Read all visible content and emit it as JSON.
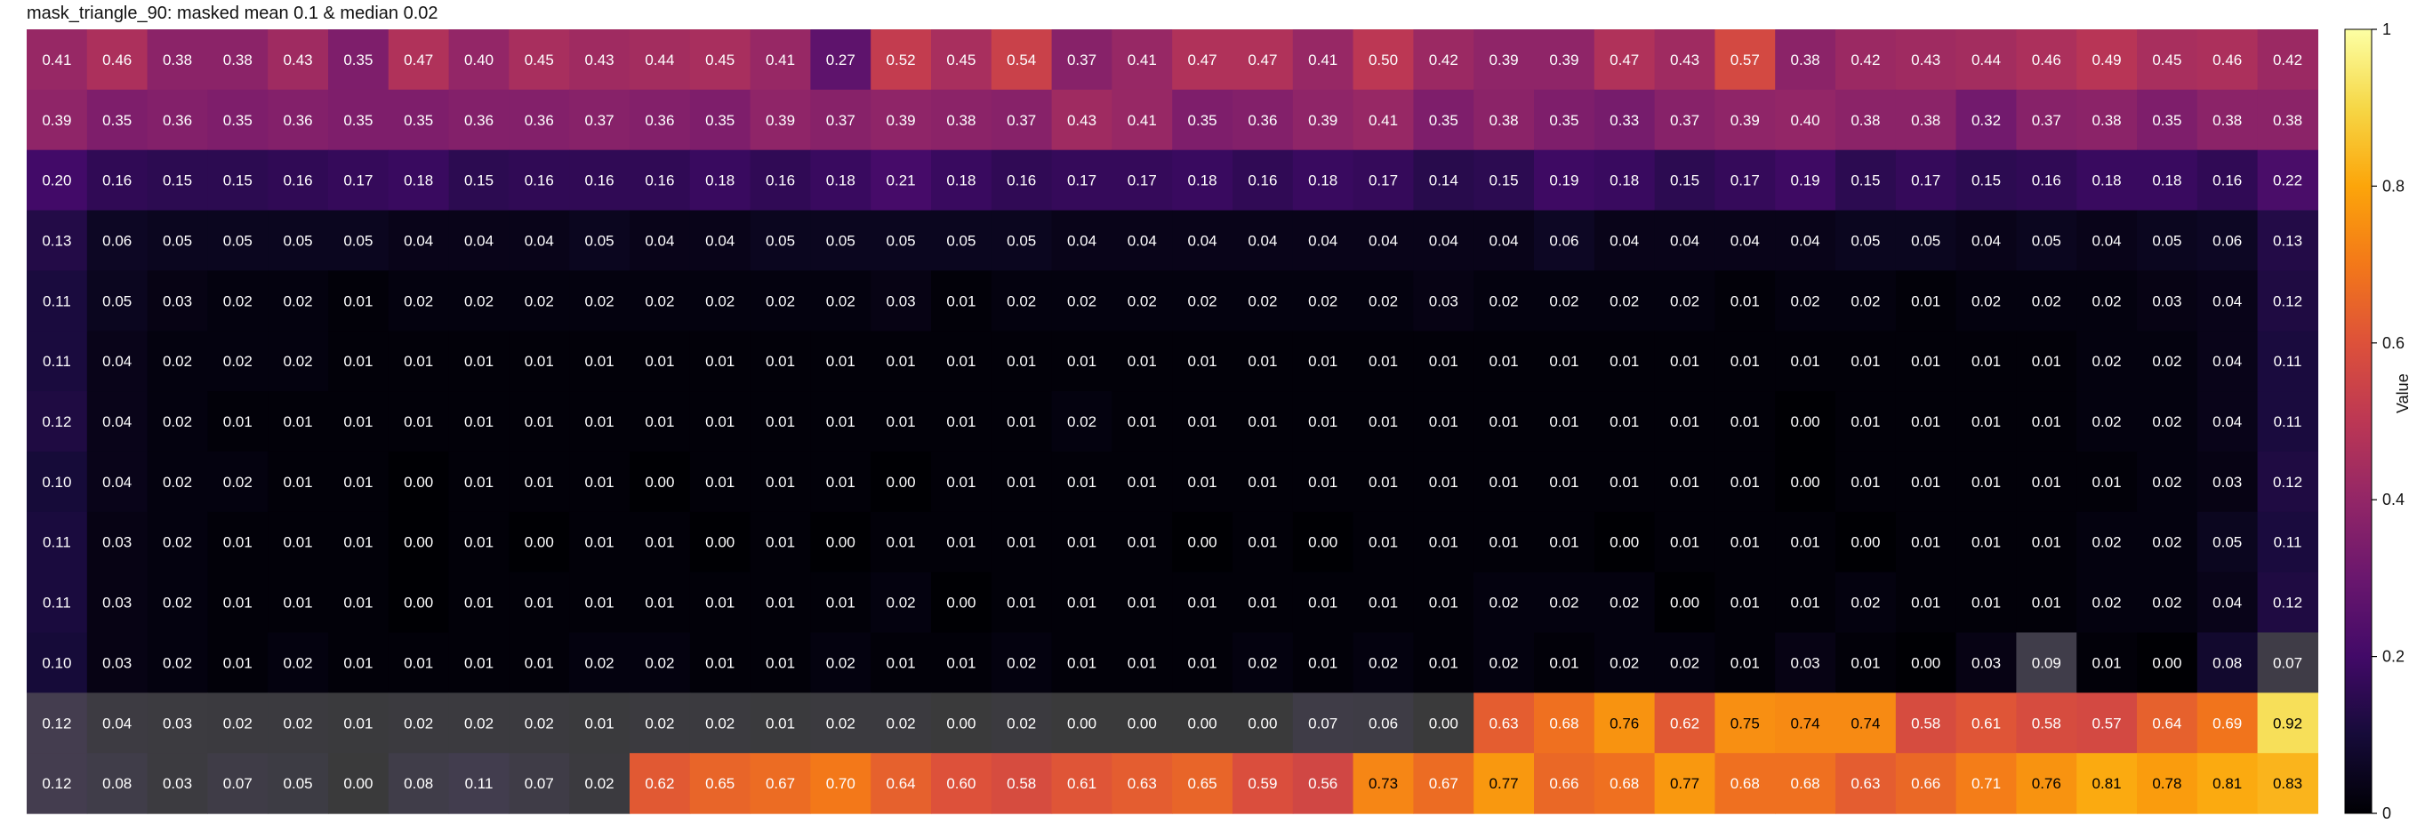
{
  "chart_data": {
    "type": "heatmap",
    "title": "mask_triangle_90: masked mean 0.1 & median 0.02",
    "colormap": "inferno",
    "vmin": 0,
    "vmax": 1,
    "colorbar_label": "Value",
    "colorbar_ticks": [
      0,
      0.2,
      0.4,
      0.6,
      0.8,
      1
    ],
    "colorbar_tick_labels": [
      "0",
      "0.2",
      "0.4",
      "0.6",
      "0.8",
      "1"
    ],
    "cell_labels": [
      [
        "0.41",
        "0.46",
        "0.38",
        "0.38",
        "0.43",
        "0.35",
        "0.47",
        "0.40",
        "0.45",
        "0.43",
        "0.44",
        "0.45",
        "0.41",
        "0.27",
        "0.52",
        "0.45",
        "0.54",
        "0.37",
        "0.41",
        "0.47",
        "0.47",
        "0.41",
        "0.50",
        "0.42",
        "0.39",
        "0.39",
        "0.47",
        "0.43",
        "0.57",
        "0.38",
        "0.42",
        "0.43",
        "0.44",
        "0.46",
        "0.49",
        "0.45",
        "0.46",
        "0.42"
      ],
      [
        "0.39",
        "0.35",
        "0.36",
        "0.35",
        "0.36",
        "0.35",
        "0.35",
        "0.36",
        "0.36",
        "0.37",
        "0.36",
        "0.35",
        "0.39",
        "0.37",
        "0.39",
        "0.38",
        "0.37",
        "0.43",
        "0.41",
        "0.35",
        "0.36",
        "0.39",
        "0.41",
        "0.35",
        "0.38",
        "0.35",
        "0.33",
        "0.37",
        "0.39",
        "0.40",
        "0.38",
        "0.38",
        "0.32",
        "0.37",
        "0.38",
        "0.35",
        "0.38",
        "0.38"
      ],
      [
        "0.20",
        "0.16",
        "0.15",
        "0.15",
        "0.16",
        "0.17",
        "0.18",
        "0.15",
        "0.16",
        "0.16",
        "0.16",
        "0.18",
        "0.16",
        "0.18",
        "0.21",
        "0.18",
        "0.16",
        "0.17",
        "0.17",
        "0.18",
        "0.16",
        "0.18",
        "0.17",
        "0.14",
        "0.15",
        "0.19",
        "0.18",
        "0.15",
        "0.17",
        "0.19",
        "0.15",
        "0.17",
        "0.15",
        "0.16",
        "0.18",
        "0.18",
        "0.16",
        "0.22"
      ],
      [
        "0.13",
        "0.06",
        "0.05",
        "0.05",
        "0.05",
        "0.05",
        "0.04",
        "0.04",
        "0.04",
        "0.05",
        "0.04",
        "0.04",
        "0.05",
        "0.05",
        "0.05",
        "0.05",
        "0.05",
        "0.04",
        "0.04",
        "0.04",
        "0.04",
        "0.04",
        "0.04",
        "0.04",
        "0.04",
        "0.06",
        "0.04",
        "0.04",
        "0.04",
        "0.04",
        "0.05",
        "0.05",
        "0.04",
        "0.05",
        "0.04",
        "0.05",
        "0.06",
        "0.13"
      ],
      [
        "0.11",
        "0.05",
        "0.03",
        "0.02",
        "0.02",
        "0.01",
        "0.02",
        "0.02",
        "0.02",
        "0.02",
        "0.02",
        "0.02",
        "0.02",
        "0.02",
        "0.03",
        "0.01",
        "0.02",
        "0.02",
        "0.02",
        "0.02",
        "0.02",
        "0.02",
        "0.02",
        "0.03",
        "0.02",
        "0.02",
        "0.02",
        "0.02",
        "0.01",
        "0.02",
        "0.02",
        "0.01",
        "0.02",
        "0.02",
        "0.02",
        "0.03",
        "0.04",
        "0.12"
      ],
      [
        "0.11",
        "0.04",
        "0.02",
        "0.02",
        "0.02",
        "0.01",
        "0.01",
        "0.01",
        "0.01",
        "0.01",
        "0.01",
        "0.01",
        "0.01",
        "0.01",
        "0.01",
        "0.01",
        "0.01",
        "0.01",
        "0.01",
        "0.01",
        "0.01",
        "0.01",
        "0.01",
        "0.01",
        "0.01",
        "0.01",
        "0.01",
        "0.01",
        "0.01",
        "0.01",
        "0.01",
        "0.01",
        "0.01",
        "0.01",
        "0.02",
        "0.02",
        "0.04",
        "0.11"
      ],
      [
        "0.12",
        "0.04",
        "0.02",
        "0.01",
        "0.01",
        "0.01",
        "0.01",
        "0.01",
        "0.01",
        "0.01",
        "0.01",
        "0.01",
        "0.01",
        "0.01",
        "0.01",
        "0.01",
        "0.01",
        "0.02",
        "0.01",
        "0.01",
        "0.01",
        "0.01",
        "0.01",
        "0.01",
        "0.01",
        "0.01",
        "0.01",
        "0.01",
        "0.01",
        "0.00",
        "0.01",
        "0.01",
        "0.01",
        "0.01",
        "0.02",
        "0.02",
        "0.04",
        "0.11"
      ],
      [
        "0.10",
        "0.04",
        "0.02",
        "0.02",
        "0.01",
        "0.01",
        "0.00",
        "0.01",
        "0.01",
        "0.01",
        "0.00",
        "0.01",
        "0.01",
        "0.01",
        "0.00",
        "0.01",
        "0.01",
        "0.01",
        "0.01",
        "0.01",
        "0.01",
        "0.01",
        "0.01",
        "0.01",
        "0.01",
        "0.01",
        "0.01",
        "0.01",
        "0.01",
        "0.00",
        "0.01",
        "0.01",
        "0.01",
        "0.01",
        "0.01",
        "0.02",
        "0.03",
        "0.12"
      ],
      [
        "0.11",
        "0.03",
        "0.02",
        "0.01",
        "0.01",
        "0.01",
        "0.00",
        "0.01",
        "0.00",
        "0.01",
        "0.01",
        "0.00",
        "0.01",
        "0.00",
        "0.01",
        "0.01",
        "0.01",
        "0.01",
        "0.01",
        "0.00",
        "0.01",
        "0.00",
        "0.01",
        "0.01",
        "0.01",
        "0.01",
        "0.00",
        "0.01",
        "0.01",
        "0.01",
        "0.00",
        "0.01",
        "0.01",
        "0.01",
        "0.02",
        "0.02",
        "0.05",
        "0.11"
      ],
      [
        "0.11",
        "0.03",
        "0.02",
        "0.01",
        "0.01",
        "0.01",
        "0.00",
        "0.01",
        "0.01",
        "0.01",
        "0.01",
        "0.01",
        "0.01",
        "0.01",
        "0.02",
        "0.00",
        "0.01",
        "0.01",
        "0.01",
        "0.01",
        "0.01",
        "0.01",
        "0.01",
        "0.01",
        "0.02",
        "0.02",
        "0.02",
        "0.00",
        "0.01",
        "0.01",
        "0.02",
        "0.01",
        "0.01",
        "0.01",
        "0.02",
        "0.02",
        "0.04",
        "0.12"
      ],
      [
        "0.10",
        "0.03",
        "0.02",
        "0.01",
        "0.02",
        "0.01",
        "0.01",
        "0.01",
        "0.01",
        "0.02",
        "0.02",
        "0.01",
        "0.01",
        "0.02",
        "0.01",
        "0.01",
        "0.02",
        "0.01",
        "0.01",
        "0.01",
        "0.02",
        "0.01",
        "0.02",
        "0.01",
        "0.02",
        "0.01",
        "0.02",
        "0.02",
        "0.01",
        "0.03",
        "0.01",
        "0.00",
        "0.03",
        "0.09",
        "0.01",
        "0.00",
        "0.08",
        "0.07"
      ],
      [
        "0.12",
        "0.04",
        "0.03",
        "0.02",
        "0.02",
        "0.01",
        "0.02",
        "0.02",
        "0.02",
        "0.01",
        "0.02",
        "0.02",
        "0.01",
        "0.02",
        "0.02",
        "0.00",
        "0.02",
        "0.00",
        "0.00",
        "0.00",
        "0.00",
        "0.07",
        "0.06",
        "0.00",
        "0.63",
        "0.68",
        "0.76",
        "0.62",
        "0.75",
        "0.74",
        "0.74",
        "0.58",
        "0.61",
        "0.58",
        "0.57",
        "0.64",
        "0.69",
        "0.92"
      ],
      [
        "0.12",
        "0.08",
        "0.03",
        "0.07",
        "0.05",
        "0.00",
        "0.08",
        "0.11",
        "0.07",
        "0.02",
        "0.62",
        "0.65",
        "0.67",
        "0.70",
        "0.64",
        "0.60",
        "0.58",
        "0.61",
        "0.63",
        "0.65",
        "0.59",
        "0.56",
        "0.73",
        "0.67",
        "0.77",
        "0.66",
        "0.68",
        "0.77",
        "0.68",
        "0.68",
        "0.63",
        "0.66",
        "0.71",
        "0.76",
        "0.81",
        "0.78",
        "0.81",
        "0.83"
      ]
    ],
    "masked_cells": [
      [
        10,
        33
      ],
      [
        10,
        37
      ],
      [
        11,
        0
      ],
      [
        11,
        1
      ],
      [
        11,
        2
      ],
      [
        11,
        3
      ],
      [
        11,
        4
      ],
      [
        11,
        5
      ],
      [
        11,
        6
      ],
      [
        11,
        7
      ],
      [
        11,
        8
      ],
      [
        11,
        9
      ],
      [
        11,
        10
      ],
      [
        11,
        11
      ],
      [
        11,
        12
      ],
      [
        11,
        13
      ],
      [
        11,
        14
      ],
      [
        11,
        15
      ],
      [
        11,
        16
      ],
      [
        11,
        17
      ],
      [
        11,
        18
      ],
      [
        11,
        19
      ],
      [
        11,
        20
      ],
      [
        11,
        21
      ],
      [
        11,
        22
      ],
      [
        11,
        23
      ],
      [
        12,
        0
      ],
      [
        12,
        1
      ],
      [
        12,
        2
      ],
      [
        12,
        3
      ],
      [
        12,
        4
      ],
      [
        12,
        5
      ],
      [
        12,
        6
      ],
      [
        12,
        7
      ],
      [
        12,
        8
      ],
      [
        12,
        9
      ]
    ],
    "masked_overlay_color": "#555555",
    "masked_overlay_opacity": 0.68
  }
}
